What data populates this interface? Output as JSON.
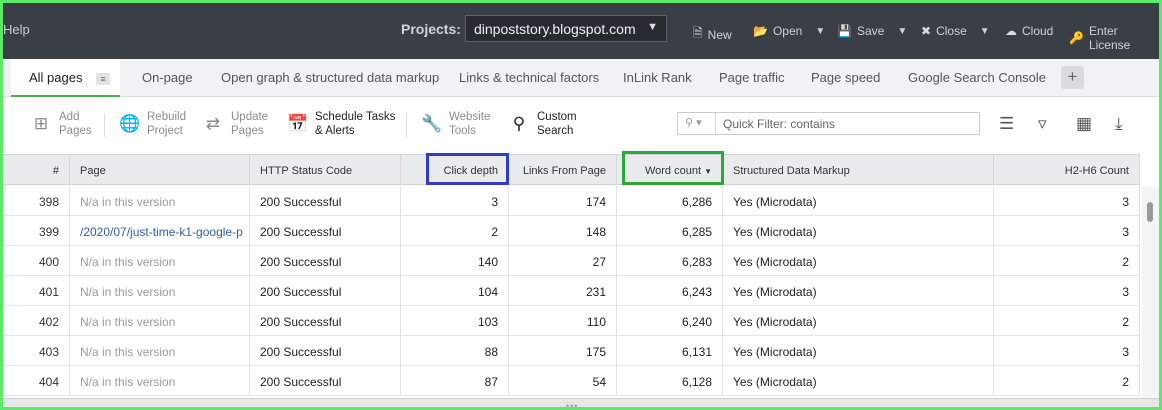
{
  "topbar": {
    "help": "Help",
    "projects_label": "Projects:",
    "project_value": "dinpoststory.blogspot.com",
    "buttons": {
      "new": "New",
      "open": "Open",
      "save": "Save",
      "close": "Close",
      "cloud": "Cloud",
      "license": "Enter License"
    }
  },
  "tabs": {
    "all_pages": "All pages",
    "on_page": "On-page",
    "open_graph": "Open graph & structured data markup",
    "links": "Links & technical factors",
    "inlink_rank": "InLink Rank",
    "page_traffic": "Page traffic",
    "page_speed": "Page speed",
    "gsc": "Google Search Console",
    "add": "+"
  },
  "toolbar": {
    "add_pages": [
      "Add",
      "Pages"
    ],
    "rebuild": [
      "Rebuild",
      "Project"
    ],
    "update_pages": [
      "Update",
      "Pages"
    ],
    "schedule": [
      "Schedule Tasks",
      "& Alerts"
    ],
    "website_tools": [
      "Website",
      "Tools"
    ],
    "custom_search": [
      "Custom",
      "Search"
    ],
    "filter_placeholder": "Quick Filter: contains"
  },
  "table": {
    "headers": {
      "num": "#",
      "page": "Page",
      "status": "HTTP Status Code",
      "click_depth": "Click depth",
      "links_from": "Links From Page",
      "word_count": "Word count",
      "structured": "Structured Data Markup",
      "h2h6": "H2-H6 Count"
    },
    "rows": [
      {
        "num": "398",
        "page": "N/a in this version",
        "status": "200 Successful",
        "depth": "3",
        "links": "174",
        "words": "6,286",
        "sd": "Yes (Microdata)",
        "h": "3"
      },
      {
        "num": "399",
        "page": "/2020/07/just-time-k1-google-p",
        "status": "200 Successful",
        "depth": "2",
        "links": "148",
        "words": "6,285",
        "sd": "Yes (Microdata)",
        "h": "3"
      },
      {
        "num": "400",
        "page": "N/a in this version",
        "status": "200 Successful",
        "depth": "140",
        "links": "27",
        "words": "6,283",
        "sd": "Yes (Microdata)",
        "h": "2"
      },
      {
        "num": "401",
        "page": "N/a in this version",
        "status": "200 Successful",
        "depth": "104",
        "links": "231",
        "words": "6,243",
        "sd": "Yes (Microdata)",
        "h": "3"
      },
      {
        "num": "402",
        "page": "N/a in this version",
        "status": "200 Successful",
        "depth": "103",
        "links": "110",
        "words": "6,240",
        "sd": "Yes (Microdata)",
        "h": "2"
      },
      {
        "num": "403",
        "page": "N/a in this version",
        "status": "200 Successful",
        "depth": "88",
        "links": "175",
        "words": "6,131",
        "sd": "Yes (Microdata)",
        "h": "3"
      },
      {
        "num": "404",
        "page": "N/a in this version",
        "status": "200 Successful",
        "depth": "87",
        "links": "54",
        "words": "6,128",
        "sd": "Yes (Microdata)",
        "h": "2"
      }
    ]
  },
  "colors": {
    "topbar": "#3a3f45",
    "highlight_blue": "#2f3cc9",
    "highlight_green": "#2aa83a",
    "frame_green": "#5ee86a",
    "link": "#2e5fa8"
  }
}
